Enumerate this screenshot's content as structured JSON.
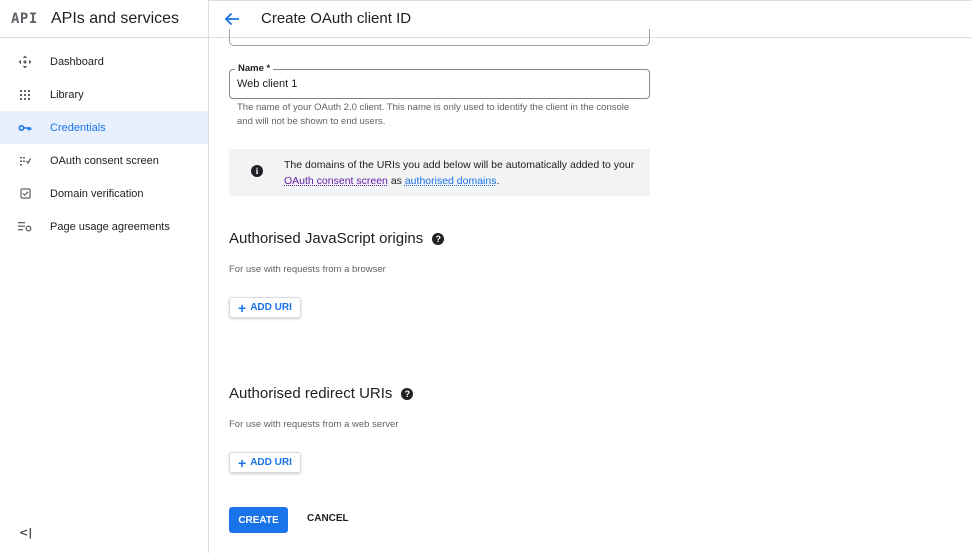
{
  "sidebar": {
    "logo": "API",
    "title": "APIs and services",
    "items": [
      {
        "label": "Dashboard",
        "icon": "dashboard-icon"
      },
      {
        "label": "Library",
        "icon": "library-icon"
      },
      {
        "label": "Credentials",
        "icon": "key-icon",
        "active": true
      },
      {
        "label": "OAuth consent screen",
        "icon": "consent-icon"
      },
      {
        "label": "Domain verification",
        "icon": "checkbox-icon"
      },
      {
        "label": "Page usage agreements",
        "icon": "settings-list-icon"
      }
    ],
    "collapse_label": "<|"
  },
  "header": {
    "title": "Create OAuth client ID"
  },
  "form": {
    "name_label": "Name *",
    "name_value": "Web client 1",
    "name_helper": "The name of your OAuth 2.0 client. This name is only used to identify the client in the console and will not be shown to end users.",
    "info": {
      "text_before": "The domains of the URIs you add below will be automatically added to your ",
      "link1": "OAuth consent screen",
      "text_mid": " as ",
      "link2": "authorised domains",
      "text_after": "."
    },
    "js_origins": {
      "title": "Authorised JavaScript origins",
      "subtitle": "For use with requests from a browser",
      "add_label": "ADD URI"
    },
    "redirect_uris": {
      "title": "Authorised redirect URIs",
      "subtitle": "For use with requests from a web server",
      "add_label": "ADD URI"
    },
    "create_label": "CREATE",
    "cancel_label": "CANCEL"
  },
  "colors": {
    "accent": "#1a73e8",
    "active_bg": "#e8f0fe",
    "link_visited": "#681da8"
  }
}
